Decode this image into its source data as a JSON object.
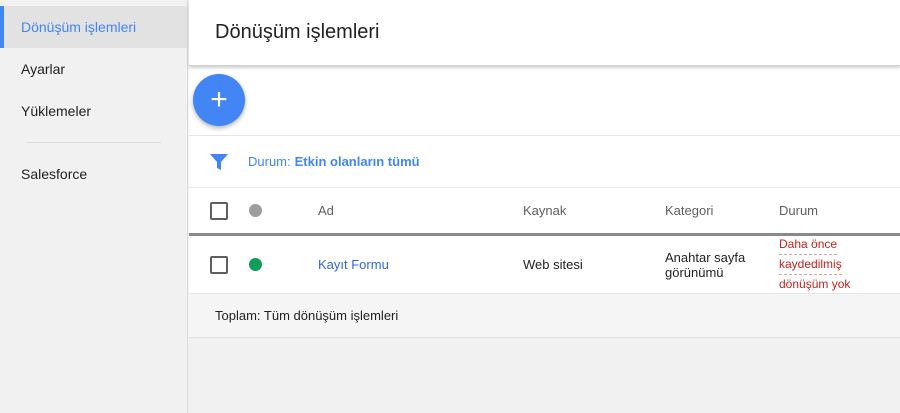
{
  "sidebar": {
    "items": [
      {
        "label": "Dönüşüm işlemleri"
      },
      {
        "label": "Ayarlar"
      },
      {
        "label": "Yüklemeler"
      },
      {
        "label": "Salesforce"
      }
    ]
  },
  "header": {
    "title": "Dönüşüm işlemleri"
  },
  "fab": {
    "icon": "plus-icon",
    "glyph": "+"
  },
  "filter": {
    "prefix": "Durum:",
    "value": "Etkin olanların tümü",
    "icon": "filter-icon"
  },
  "table": {
    "columns": {
      "name": "Ad",
      "source": "Kaynak",
      "category": "Kategori",
      "status": "Durum"
    },
    "header_status_dot_color": "#9e9e9e",
    "rows": [
      {
        "status_dot_color": "#0f9d58",
        "name": "Kayıt Formu",
        "source": "Web sitesi",
        "category": "Anahtar sayfa görünümü",
        "status_lines": [
          "Daha önce",
          "kaydedilmiş",
          "dönüşüm yok"
        ]
      }
    ],
    "footer": "Toplam: Tüm dönüşüm işlemleri"
  },
  "colors": {
    "accent": "#4285f4",
    "link": "#3367d6",
    "error": "#c5221f",
    "active_dot": "#0f9d58"
  }
}
